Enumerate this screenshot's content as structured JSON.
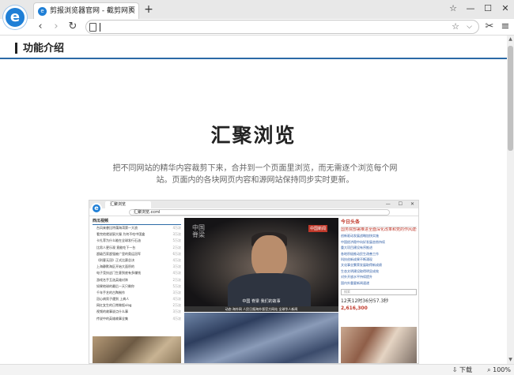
{
  "browser": {
    "tab_title": "剪报浏览器官网 - 截剪网页",
    "tab_favicon": "e",
    "new_tab": "+",
    "logo_letter": "e",
    "window_controls": [
      "☆",
      "—",
      "☐",
      "✕"
    ],
    "nav": {
      "back": "‹",
      "forward": "›",
      "refresh": "↻",
      "address_value": "",
      "bookmark_icon": "☆",
      "dropdown_icon": "⌵",
      "scissors_icon": "✂",
      "menu_icon": "≡"
    }
  },
  "page": {
    "section_title": "功能介绍",
    "hero_title": "汇聚浏览",
    "hero_desc": "把不同网站的精华内容裁剪下来，合并到一个页面里浏览，而无需逐个浏览每个网站。页面内的各块网页内容和源网站保持同步实时更新。"
  },
  "screenshot": {
    "tab_title": "汇聚浏览",
    "address": "汇聚浏览.ccml",
    "window_controls": "— ☐ ✕",
    "left_title": "西瓜视频",
    "left_list": [
      {
        "text": "台风来袭比特蒲海湾第一大浪",
        "views": "4万次"
      },
      {
        "text": "看完他就说厨大服 为何不吃中国盒",
        "views": "3万次"
      },
      {
        "text": "卡扎菲为什么能在全球发行石油",
        "views": "5万次"
      },
      {
        "text": "比男人更乐观 竟能吃下一台",
        "views": "2万次"
      },
      {
        "text": "超级百家超强被广里的奥运冠军",
        "views": "6万次"
      },
      {
        "text": "《刑客无冠》正式比赛总决",
        "views": "4万次"
      },
      {
        "text": "上海静默海区开始大面积的",
        "views": "3万次"
      },
      {
        "text": "电子竞技这门生意到底有多赚钱",
        "views": "4万次"
      },
      {
        "text": "游戏名手互选英雄对阵",
        "views": "2万次"
      },
      {
        "text": "如果地球的最后一天只剩你",
        "views": "5万次"
      },
      {
        "text": "千年手艺的古陶制作",
        "views": "3万次"
      },
      {
        "text": "冠心病男子遇到 上病人",
        "views": "4万次"
      },
      {
        "text": "网红女生的日常做饭vlog",
        "views": "2万次"
      },
      {
        "text": "视频的故事说点什么事",
        "views": "3万次"
      },
      {
        "text": "传说中的英雄故事全集",
        "views": "4万次"
      }
    ],
    "video_badge": "中国新闻",
    "video_caption": "中国 脊梁 我们的故事",
    "video_vertical": "中国脊梁",
    "news_caption": "动态·海外网 人民日报海外版官方网站 全球华人新闻",
    "right_head": "今日头条",
    "right_list": [
      "国务院部署推进全面深化改革和党的作风建设",
      "创新驱动发展战略加快实施",
      "中国经济稳中向好发展态势持续",
      "重大项目建设有序推进",
      "各地积极推动民生改善工作",
      "科技创新成果不断涌现",
      "文化事业繁荣发展取得新成绩",
      "生态文明建设取得明显成效",
      "对外开放水平持续提升",
      "国内外重要新闻速递"
    ],
    "search_placeholder": "搜索",
    "counter_label": "12天12时36分57.3秒",
    "counter_value": "2,616,300"
  },
  "scrollbar": {
    "up": "▲",
    "down": "▼",
    "thumb_fraction": 0.32
  },
  "status": {
    "download": "⇩ 下载",
    "zoom": "⌕ 100%"
  }
}
